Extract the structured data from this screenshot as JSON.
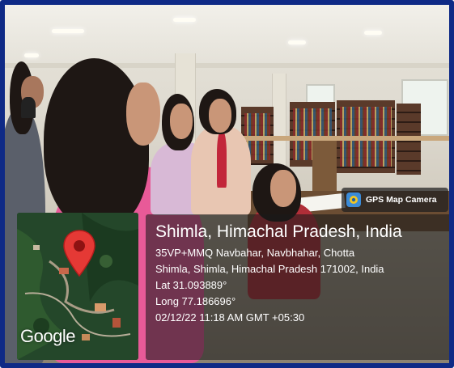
{
  "stamp": {
    "app_name": "GPS Map Camera",
    "icon": "gps-camera-app-icon"
  },
  "map": {
    "provider_mark": "Google",
    "icon": "location-pin-icon",
    "pin_color": "#e53935"
  },
  "location": {
    "title": "Shimla, Himachal Pradesh, India",
    "address_line_1": "35VP+MMQ Navbahar, Navbhahar, Chotta",
    "address_line_2": "Shimla, Shimla, Himachal Pradesh 171002, India",
    "latitude": "Lat 31.093889°",
    "longitude": "Long 77.186696°",
    "timestamp": "02/12/22 11:18 AM GMT +05:30"
  },
  "colors": {
    "frame_border": "#0f2a86",
    "overlay_bg": "rgba(25,25,25,0.58)"
  }
}
